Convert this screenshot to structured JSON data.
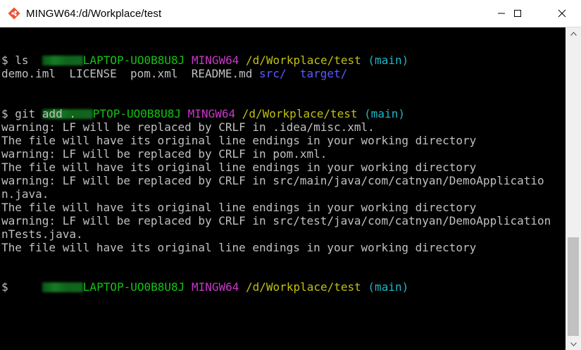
{
  "window": {
    "title": "MINGW64:/d/Workplace/test",
    "icon": "git-bash-icon",
    "buttons": {
      "minimize": "minimize-icon",
      "maximize": "maximize-icon",
      "close": "close-icon"
    }
  },
  "prompt": {
    "host1": "LAPTOP-UO0B8U8J",
    "host2": "PTOP-UO0B8U8J",
    "shell": "MINGW64",
    "path": "/d/Workplace/test",
    "branch": "(main)",
    "symbol": "$"
  },
  "commands": {
    "ls": "$ ls",
    "git_add": "$ git add ."
  },
  "ls_output": {
    "files": "demo.iml  LICENSE  pom.xml  README.md ",
    "dir1": "src/",
    "dir2": "target/"
  },
  "output_lines": [
    "warning: LF will be replaced by CRLF in .idea/misc.xml.",
    "The file will have its original line endings in your working directory",
    "warning: LF will be replaced by CRLF in pom.xml.",
    "The file will have its original line endings in your working directory",
    "warning: LF will be replaced by CRLF in src/main/java/com/catnyan/DemoApplicatio",
    "n.java.",
    "The file will have its original line endings in your working directory",
    "warning: LF will be replaced by CRLF in src/test/java/com/catnyan/DemoApplication",
    "nTests.java.",
    "The file will have its original line endings in your working directory"
  ],
  "scrollbar": {
    "position": 0.9
  },
  "colors": {
    "user_host": "#13c213",
    "shell": "#c837c8",
    "path": "#c0c013",
    "branch": "#1fb6c6",
    "directory": "#5a5aff",
    "text": "#c0c0c0",
    "background": "#000000"
  }
}
